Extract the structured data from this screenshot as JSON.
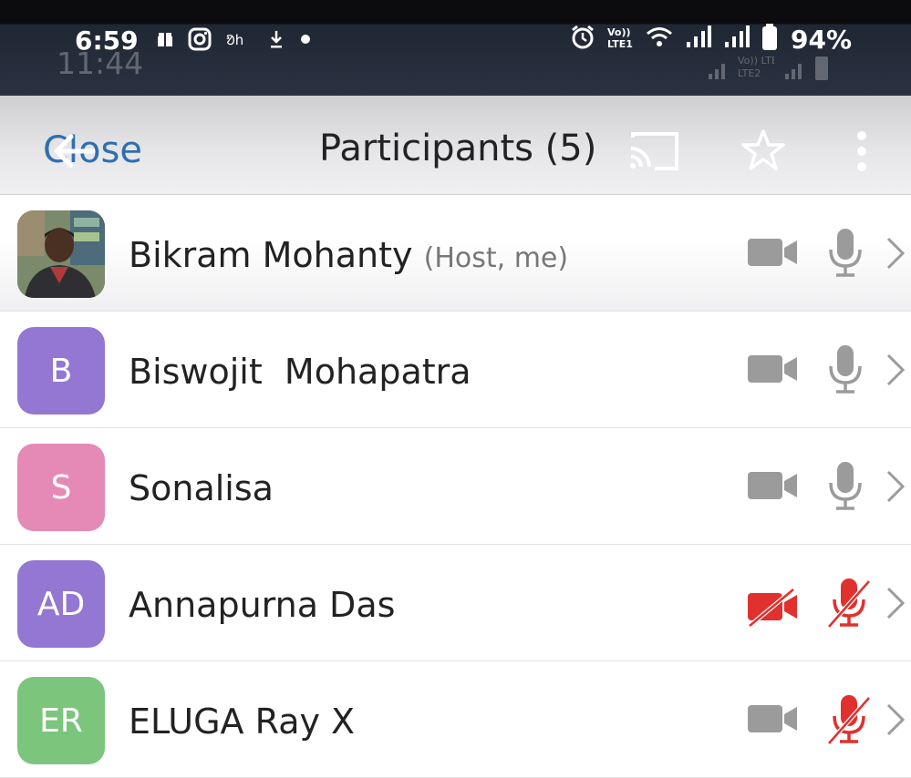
{
  "status_bar": {
    "time": "6:59",
    "ghost_time": "11:44",
    "battery": "94%",
    "left_icons": [
      "gift-icon",
      "instagram-icon",
      "dailyhunt-icon",
      "download-icon",
      "dot-icon"
    ],
    "right_icons": [
      "alarm-icon",
      "volte-icon",
      "wifi-icon",
      "signal-icon",
      "signal-icon",
      "battery-icon"
    ]
  },
  "header": {
    "close_label": "Close",
    "title": "Participants (5)",
    "icons": [
      "back-arrow-icon",
      "cast-icon",
      "star-icon",
      "more-vertical-icon"
    ]
  },
  "colors": {
    "accent": "#2f6fb0",
    "muted_icon": "#9b9b9b",
    "red_off": "#e0312f"
  },
  "participants": [
    {
      "name": "Bikram Mohanty",
      "tag": "(Host, me)",
      "initials": "",
      "avatar_color": "#7a6a55",
      "video_on": true,
      "audio_on": true,
      "photo": true
    },
    {
      "name": "Biswojit  Mohapatra",
      "tag": "",
      "initials": "B",
      "avatar_color": "#9377d3",
      "video_on": true,
      "audio_on": true,
      "photo": false
    },
    {
      "name": "Sonalisa",
      "tag": "",
      "initials": "S",
      "avatar_color": "#e58ab7",
      "video_on": true,
      "audio_on": true,
      "photo": false
    },
    {
      "name": "Annapurna Das",
      "tag": "",
      "initials": "AD",
      "avatar_color": "#9377d3",
      "video_on": false,
      "audio_on": false,
      "photo": false
    },
    {
      "name": "ELUGA Ray X",
      "tag": "",
      "initials": "ER",
      "avatar_color": "#7bc57d",
      "video_on": true,
      "audio_on": false,
      "photo": false
    }
  ]
}
